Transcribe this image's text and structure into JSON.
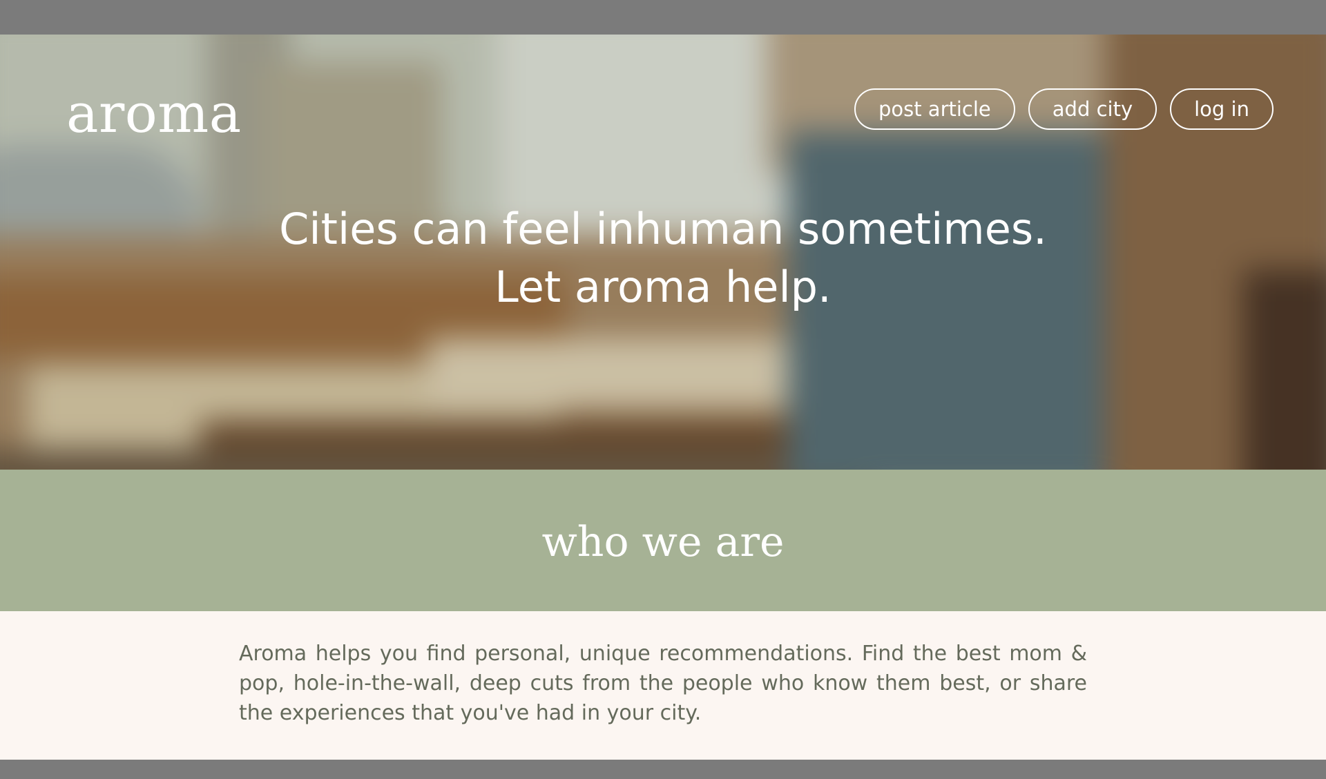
{
  "brand": {
    "logo_text": "aroma"
  },
  "nav": {
    "items": [
      {
        "label": "post article"
      },
      {
        "label": "add city"
      },
      {
        "label": "log in"
      }
    ]
  },
  "hero": {
    "headline_line1": "Cities can feel inhuman sometimes.",
    "headline_line2": "Let aroma help."
  },
  "about": {
    "heading": "who we are",
    "body": "Aroma helps you find personal, unique recommendations. Find the best mom & pop, hole-in-the-wall, deep cuts from the people who know them best, or share the experiences that you've had in your city."
  },
  "colors": {
    "band_green": "#a6b295",
    "body_background": "#fcf6f2",
    "body_text": "#646a5b",
    "outer_frame": "#7b7b7b"
  }
}
